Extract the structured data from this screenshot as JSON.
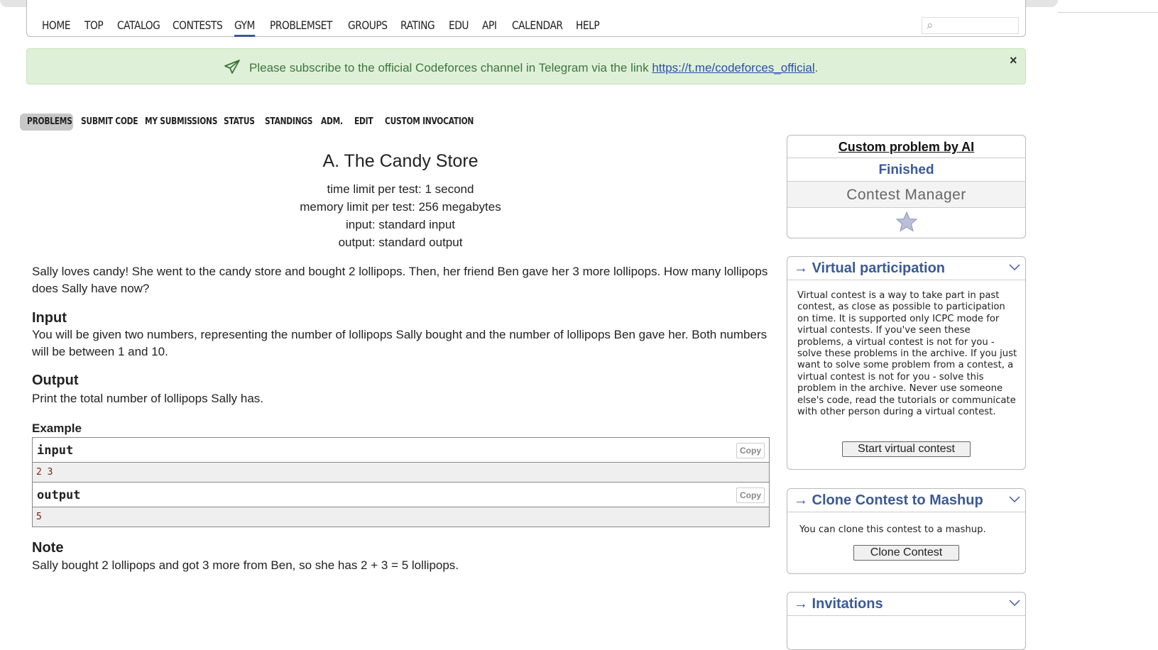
{
  "nav": {
    "items": [
      "HOME",
      "TOP",
      "CATALOG",
      "CONTESTS",
      "GYM",
      "PROBLEMSET",
      "GROUPS",
      "RATING",
      "EDU",
      "API",
      "CALENDAR",
      "HELP"
    ],
    "active": "GYM"
  },
  "alert": {
    "text": "Please subscribe to the official Codeforces channel in Telegram via the link ",
    "link": "https://t.me/codeforces_official",
    "suffix": ".",
    "close": "×"
  },
  "tabs": [
    "PROBLEMS",
    "SUBMIT CODE",
    "MY SUBMISSIONS",
    "STATUS",
    "STANDINGS",
    "ADM.",
    "EDIT",
    "CUSTOM INVOCATION"
  ],
  "problem": {
    "title": "A. The Candy Store",
    "time_limit": "time limit per test: 1 second",
    "memory_limit": "memory limit per test: 256 megabytes",
    "input_file": "input: standard input",
    "output_file": "output: standard output",
    "statement": "Sally loves candy! She went to the candy store and bought 2 lollipops. Then, her friend Ben gave her 3 more lollipops. How many lollipops does Sally have now?",
    "input_title": "Input",
    "input_text": "You will be given two numbers, representing the number of lollipops Sally bought and the number of lollipops Ben gave her. Both numbers will be between 1 and 10.",
    "output_title": "Output",
    "output_text": "Print the total number of lollipops Sally has.",
    "example_title": "Example",
    "example_input_label": "input",
    "example_input": "2 3",
    "example_output_label": "output",
    "example_output": "5",
    "copy_label": "Copy",
    "note_title": "Note",
    "note_text": "Sally bought 2 lollipops and got 3 more from Ben, so she has 2 + 3 = 5 lollipops."
  },
  "sidebar": {
    "contest_name": "Custom problem by AI",
    "status": "Finished",
    "manager": "Contest Manager",
    "virtual": {
      "title": "→ Virtual participation",
      "text": "Virtual contest is a way to take part in past contest, as close as possible to participation on time. It is supported only ICPC mode for virtual contests. If you've seen these problems, a virtual contest is not for you - solve these problems in the archive. If you just want to solve some problem from a contest, a virtual contest is not for you - solve this problem in the archive. Never use someone else's code, read the tutorials or communicate with other person during a virtual contest.",
      "button": "Start virtual contest"
    },
    "clone": {
      "title": "→ Clone Contest to Mashup",
      "text": "You can clone this contest to a mashup.",
      "button": "Clone Contest"
    },
    "invitations": {
      "title": "→ Invitations"
    }
  },
  "colors": {
    "link_blue": "#3b5998",
    "alert_bg": "#dff0d8",
    "alert_text": "#3c763d"
  }
}
